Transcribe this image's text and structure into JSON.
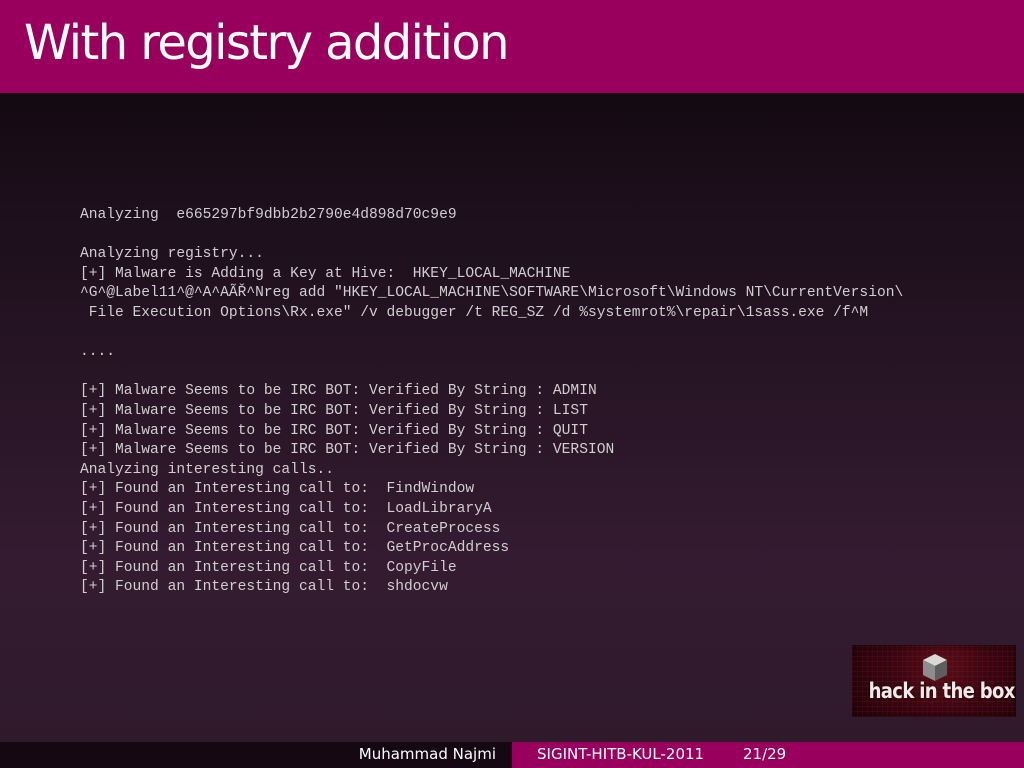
{
  "slide": {
    "title": "With registry addition"
  },
  "terminal": {
    "lines": [
      "Analyzing  e665297bf9dbb2b2790e4d898d70c9e9",
      "",
      "Analyzing registry...",
      "[+] Malware is Adding a Key at Hive:  HKEY_LOCAL_MACHINE",
      "^G^@Label11^@^A^AÃŘ^Nreg add \"HKEY_LOCAL_MACHINE\\SOFTWARE\\Microsoft\\Windows NT\\CurrentVersion\\",
      " File Execution Options\\Rx.exe\" /v debugger /t REG_SZ /d %systemrot%\\repair\\1sass.exe /f^M",
      "",
      "....",
      "",
      "[+] Malware Seems to be IRC BOT: Verified By String : ADMIN",
      "[+] Malware Seems to be IRC BOT: Verified By String : LIST",
      "[+] Malware Seems to be IRC BOT: Verified By String : QUIT",
      "[+] Malware Seems to be IRC BOT: Verified By String : VERSION",
      "Analyzing interesting calls..",
      "[+] Found an Interesting call to:  FindWindow",
      "[+] Found an Interesting call to:  LoadLibraryA",
      "[+] Found an Interesting call to:  CreateProcess",
      "[+] Found an Interesting call to:  GetProcAddress",
      "[+] Found an Interesting call to:  CopyFile",
      "[+] Found an Interesting call to:  shdocvw"
    ]
  },
  "logo": {
    "text": "hack in the box",
    "icon": "cube-icon"
  },
  "footer": {
    "author": "Muhammad Najmi",
    "event": "SIGINT-HITB-KUL-2011",
    "page": "21/29"
  },
  "colors": {
    "accent": "#99005d",
    "footer_dark": "#160812",
    "terminal_text": "#d2cdd0"
  }
}
